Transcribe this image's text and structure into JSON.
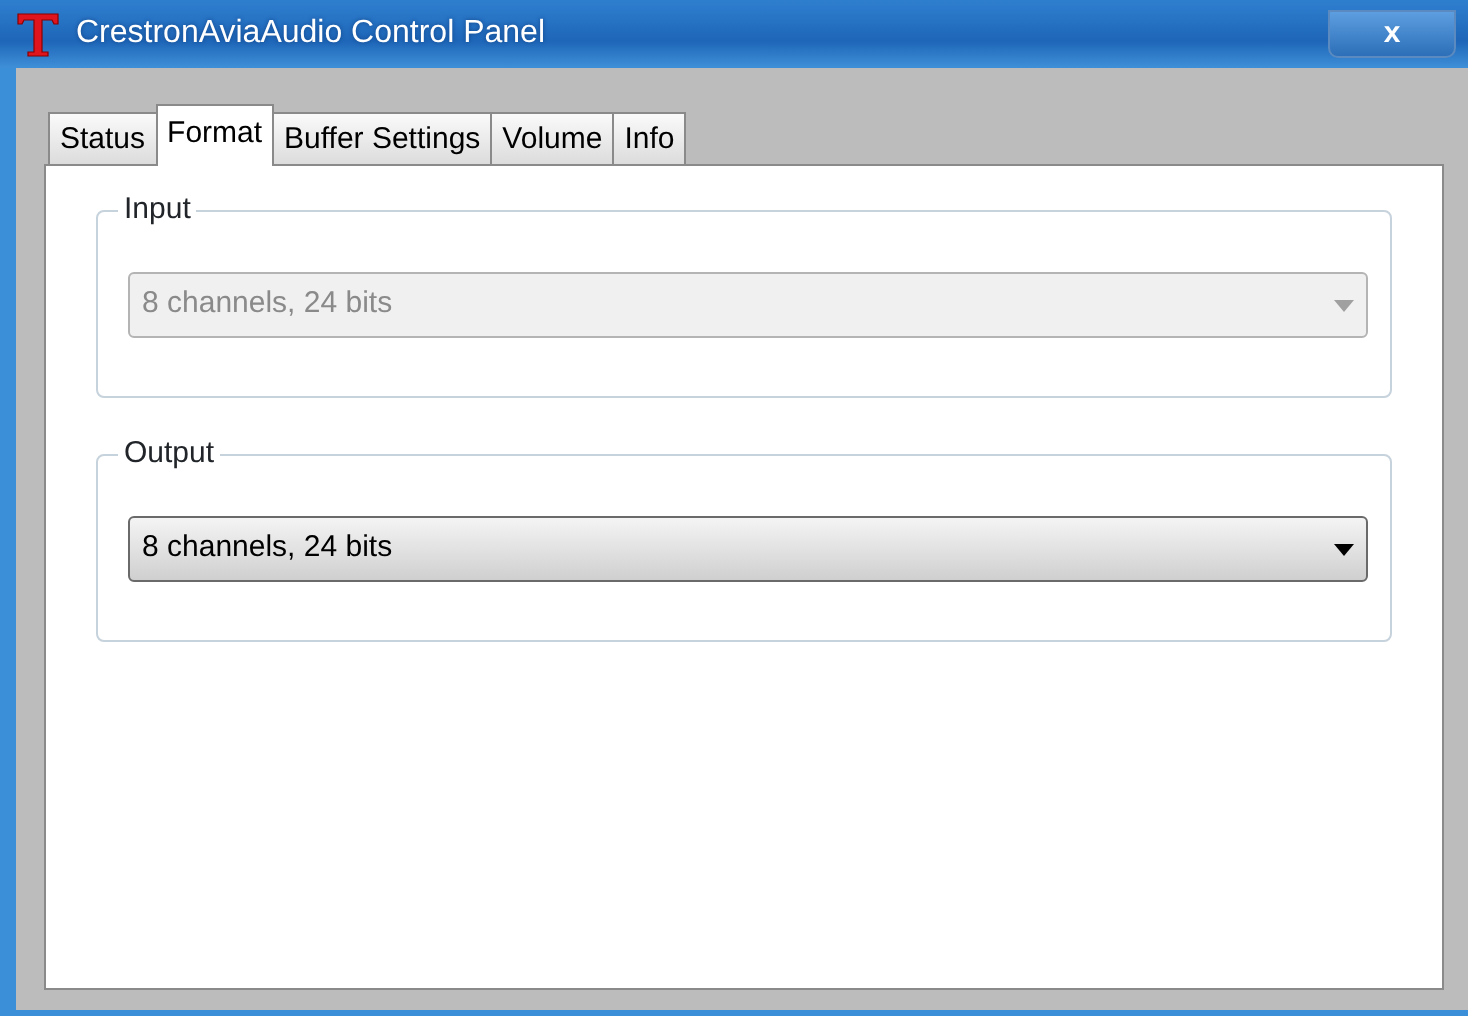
{
  "window": {
    "title": "CrestronAviaAudio Control Panel",
    "close": "x"
  },
  "tabs": [
    {
      "label": "Status",
      "selected": false
    },
    {
      "label": "Format",
      "selected": true
    },
    {
      "label": "Buffer Settings",
      "selected": false
    },
    {
      "label": "Volume",
      "selected": false
    },
    {
      "label": "Info",
      "selected": false
    }
  ],
  "groups": [
    {
      "label": "Input",
      "value": "8 channels, 24 bits",
      "disabled": true
    },
    {
      "label": "Output",
      "value": "8 channels, 24 bits",
      "disabled": false
    }
  ]
}
